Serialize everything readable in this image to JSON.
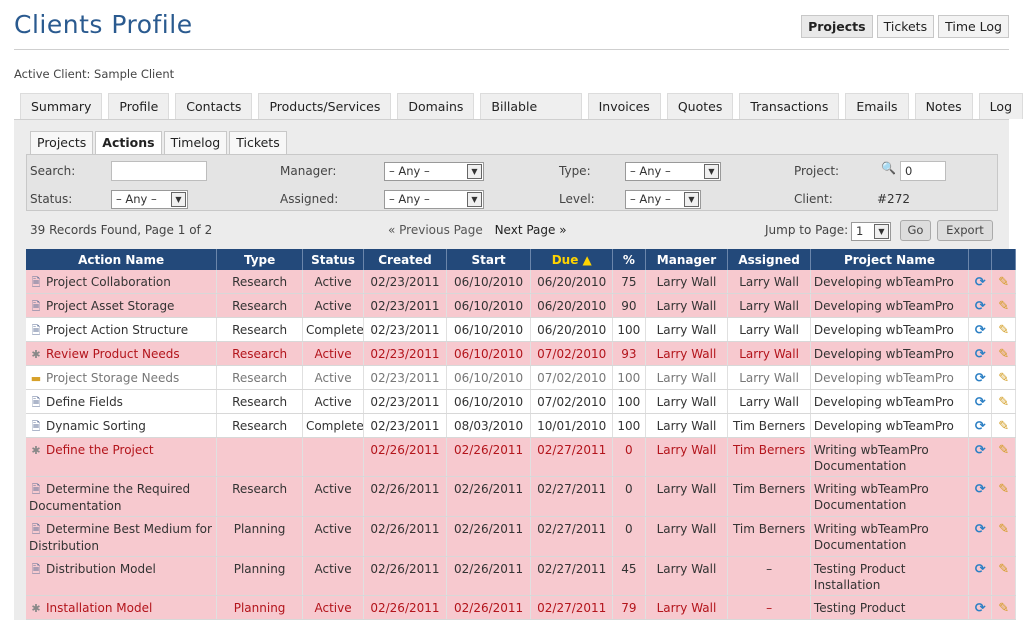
{
  "page": {
    "title": "Clients Profile",
    "active_client": "Active Client: Sample Client"
  },
  "top_tabs": [
    {
      "label": "Projects",
      "active": true
    },
    {
      "label": "Tickets",
      "active": false
    },
    {
      "label": "Time Log",
      "active": false
    }
  ],
  "main_tabs": [
    "Summary",
    "Profile",
    "Contacts",
    "Products/Services",
    "Domains",
    "Billable Items",
    "Invoices",
    "Quotes",
    "Transactions",
    "Emails",
    "Notes",
    "Log"
  ],
  "sub_tabs": [
    {
      "label": "Projects",
      "active": false
    },
    {
      "label": "Actions",
      "active": true
    },
    {
      "label": "Timelog",
      "active": false
    },
    {
      "label": "Tickets",
      "active": false
    }
  ],
  "filters": {
    "search_label": "Search:",
    "search_value": "",
    "status_label": "Status:",
    "status_value": "– Any –",
    "manager_label": "Manager:",
    "manager_value": "– Any –",
    "assigned_label": "Assigned:",
    "assigned_value": "– Any –",
    "type_label": "Type:",
    "type_value": "– Any –",
    "level_label": "Level:",
    "level_value": "– Any –",
    "project_label": "Project:",
    "project_value": "0",
    "client_label": "Client:",
    "client_value": "#272"
  },
  "pagination": {
    "records": "39 Records Found, Page 1 of 2",
    "prev": "« Previous Page",
    "next": "Next Page »",
    "jump_label": "Jump to Page:",
    "jump_value": "1",
    "go": "Go",
    "export": "Export"
  },
  "table": {
    "headers": [
      "Action Name",
      "Type",
      "Status",
      "Created",
      "Start",
      "Due ▲",
      "%",
      "Manager",
      "Assigned",
      "Project Name",
      "",
      ""
    ],
    "rows": [
      {
        "icon": "doc",
        "style": "pink",
        "name": "Project Collaboration",
        "type": "Research",
        "status": "Active",
        "created": "02/23/2011",
        "start": "06/10/2010",
        "due": "06/20/2010",
        "pct": "75",
        "manager": "Larry Wall",
        "assigned": "Larry Wall",
        "project": "Developing wbTeamPro"
      },
      {
        "icon": "doc",
        "style": "pink",
        "name": "Project Asset Storage",
        "type": "Research",
        "status": "Active",
        "created": "02/23/2011",
        "start": "06/10/2010",
        "due": "06/20/2010",
        "pct": "90",
        "manager": "Larry Wall",
        "assigned": "Larry Wall",
        "project": "Developing wbTeamPro"
      },
      {
        "icon": "doc",
        "style": "white",
        "name": "Project Action Structure",
        "type": "Research",
        "status": "Complete",
        "created": "02/23/2011",
        "start": "06/10/2010",
        "due": "06/20/2010",
        "pct": "100",
        "manager": "Larry Wall",
        "assigned": "Larry Wall",
        "project": "Developing wbTeamPro"
      },
      {
        "icon": "gear",
        "style": "pink overdue",
        "name": "Review Product Needs",
        "type": "Research",
        "status": "Active",
        "created": "02/23/2011",
        "start": "06/10/2010",
        "due": "07/02/2010",
        "pct": "93",
        "manager": "Larry Wall",
        "assigned": "Larry Wall",
        "project": "Developing wbTeamPro"
      },
      {
        "icon": "folder",
        "style": "white grey",
        "name": "Project Storage Needs",
        "type": "Research",
        "status": "Active",
        "created": "02/23/2011",
        "start": "06/10/2010",
        "due": "07/02/2010",
        "pct": "100",
        "manager": "Larry Wall",
        "assigned": "Larry Wall",
        "project": "Developing wbTeamPro"
      },
      {
        "icon": "doc",
        "style": "white",
        "name": "Define Fields",
        "type": "Research",
        "status": "Active",
        "created": "02/23/2011",
        "start": "06/10/2010",
        "due": "07/02/2010",
        "pct": "100",
        "manager": "Larry Wall",
        "assigned": "Larry Wall",
        "project": "Developing wbTeamPro"
      },
      {
        "icon": "doc",
        "style": "white",
        "name": "Dynamic Sorting",
        "type": "Research",
        "status": "Complete",
        "created": "02/23/2011",
        "start": "08/03/2010",
        "due": "10/01/2010",
        "pct": "100",
        "manager": "Larry Wall",
        "assigned": "Tim Berners",
        "project": "Developing wbTeamPro"
      },
      {
        "icon": "gear",
        "style": "pink overdue",
        "name": "Define the Project",
        "type": "",
        "status": "",
        "created": "02/26/2011",
        "start": "02/26/2011",
        "due": "02/27/2011",
        "pct": "0",
        "manager": "Larry Wall",
        "assigned": "Tim Berners",
        "project": "Writing wbTeamPro Documentation"
      },
      {
        "icon": "doc",
        "style": "pink",
        "name": "Determine the Required Documentation",
        "type": "Research",
        "status": "Active",
        "created": "02/26/2011",
        "start": "02/26/2011",
        "due": "02/27/2011",
        "pct": "0",
        "manager": "Larry Wall",
        "assigned": "Tim Berners",
        "project": "Writing wbTeamPro Documentation"
      },
      {
        "icon": "doc",
        "style": "pink",
        "name": "Determine Best Medium for Distribution",
        "type": "Planning",
        "status": "Active",
        "created": "02/26/2011",
        "start": "02/26/2011",
        "due": "02/27/2011",
        "pct": "0",
        "manager": "Larry Wall",
        "assigned": "Tim Berners",
        "project": "Writing wbTeamPro Documentation"
      },
      {
        "icon": "doc",
        "style": "pink",
        "name": "Distribution Model",
        "type": "Planning",
        "status": "Active",
        "created": "02/26/2011",
        "start": "02/26/2011",
        "due": "02/27/2011",
        "pct": "45",
        "manager": "Larry Wall",
        "assigned": "–",
        "project": "Testing Product Installation"
      },
      {
        "icon": "gear",
        "style": "pink overdue",
        "name": "Installation Model",
        "type": "Planning",
        "status": "Active",
        "created": "02/26/2011",
        "start": "02/26/2011",
        "due": "02/27/2011",
        "pct": "79",
        "manager": "Larry Wall",
        "assigned": "–",
        "project": "Testing Product"
      }
    ]
  }
}
